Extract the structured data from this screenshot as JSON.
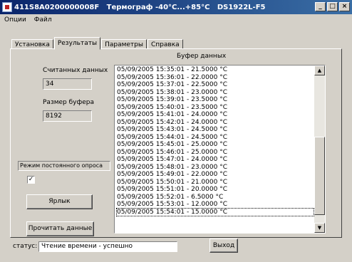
{
  "window": {
    "title": "411S8A0200000008F   Термограф -40°C...+85°C   DS1922L-F5"
  },
  "menu": [
    "Опции",
    "Файл"
  ],
  "tabs": [
    "Установка",
    "Результаты",
    "Параметры",
    "Справка"
  ],
  "results": {
    "read_count_label": "Считанных данных",
    "read_count_value": "34",
    "buffer_size_label": "Размер буфера",
    "buffer_size_value": "8192",
    "buffer_title": "Буфер данных",
    "polling_mode_label": "Режим постоянного опроса",
    "polling_checked": true,
    "shortcut_button": "Ярлык",
    "read_data_button": "Прочитать данные",
    "buffer_rows": [
      "05/09/2005 15:35:01 - 21.5000 °C",
      "05/09/2005 15:36:01 - 22.0000 °C",
      "05/09/2005 15:37:01 - 22.5000 °C",
      "05/09/2005 15:38:01 - 23.0000 °C",
      "05/09/2005 15:39:01 - 23.5000 °C",
      "05/09/2005 15:40:01 - 23.5000 °C",
      "05/09/2005 15:41:01 - 24.0000 °C",
      "05/09/2005 15:42:01 - 24.0000 °C",
      "05/09/2005 15:43:01 - 24.5000 °C",
      "05/09/2005 15:44:01 - 24.5000 °C",
      "05/09/2005 15:45:01 - 25.0000 °C",
      "05/09/2005 15:46:01 - 25.0000 °C",
      "05/09/2005 15:47:01 - 24.0000 °C",
      "05/09/2005 15:48:01 - 23.0000 °C",
      "05/09/2005 15:49:01 - 22.0000 °C",
      "05/09/2005 15:50:01 - 21.0000 °C",
      "05/09/2005 15:51:01 - 20.0000 °C",
      "05/09/2005 15:52:01 -  6.5000 °C",
      "05/09/2005 15:53:01 - 12.0000 °C",
      "05/09/2005 15:54:01 - 15.0000 °C"
    ]
  },
  "status": {
    "label": "статус:",
    "value": "Чтение времени - успешно"
  },
  "exit_button": "Выход"
}
